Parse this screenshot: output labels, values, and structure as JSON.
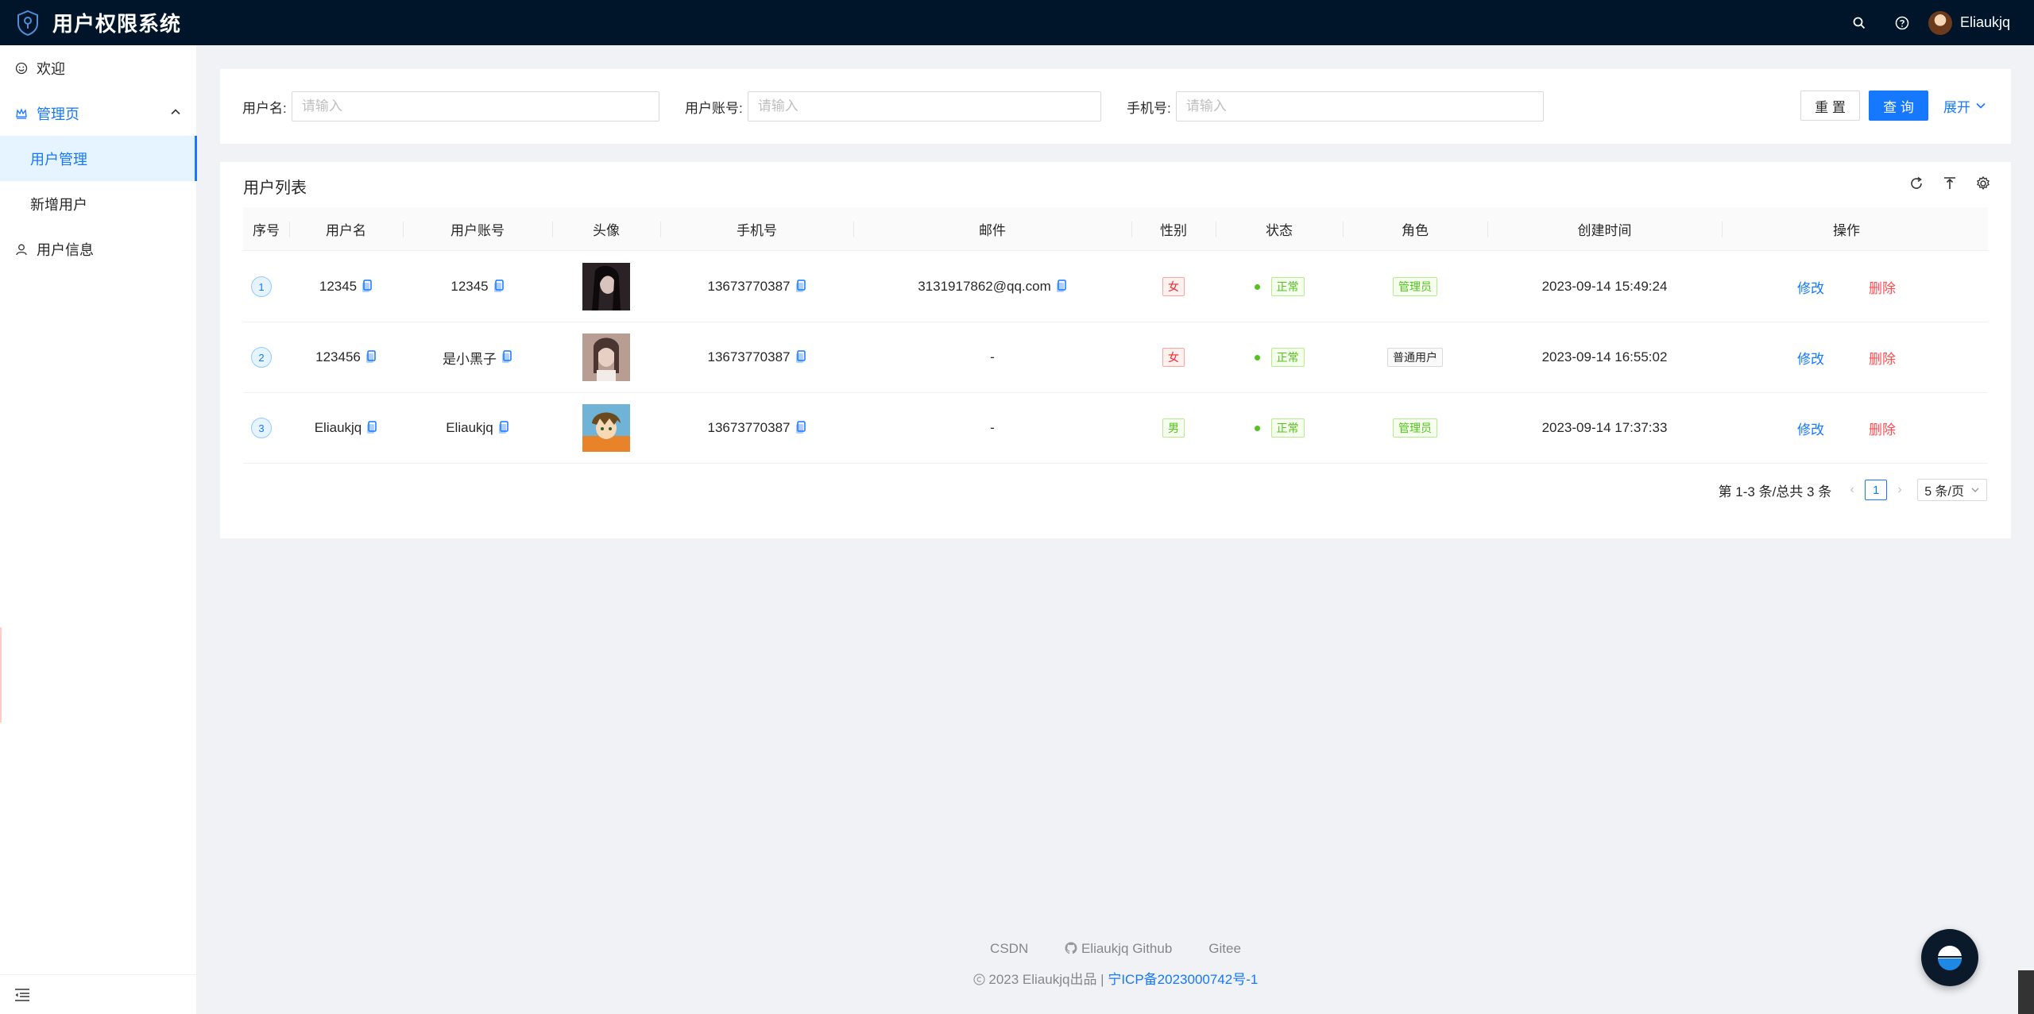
{
  "header": {
    "app_title": "用户权限系统",
    "user_name": "Eliaukjq"
  },
  "sidebar": {
    "items": [
      {
        "label": "欢迎",
        "icon": "smile-icon"
      },
      {
        "label": "管理页",
        "icon": "crown-icon"
      },
      {
        "label": "用户管理"
      },
      {
        "label": "新增用户"
      },
      {
        "label": "用户信息",
        "icon": "user-icon"
      }
    ]
  },
  "search": {
    "username_label": "用户名:",
    "account_label": "用户账号:",
    "phone_label": "手机号:",
    "placeholder": "请输入",
    "reset_label": "重 置",
    "query_label": "查 询",
    "expand_label": "展开"
  },
  "table": {
    "title": "用户列表",
    "columns": [
      "序号",
      "用户名",
      "用户账号",
      "头像",
      "手机号",
      "邮件",
      "性别",
      "状态",
      "角色",
      "创建时间",
      "操作"
    ],
    "rows": [
      {
        "index": "1",
        "username": "12345",
        "account": "12345",
        "phone": "13673770387",
        "email": "3131917862@qq.com",
        "gender": "女",
        "status": "正常",
        "role": "管理员",
        "created": "2023-09-14 15:49:24",
        "edit": "修改",
        "delete": "删除"
      },
      {
        "index": "2",
        "username": "123456",
        "account": "是小黑子",
        "phone": "13673770387",
        "email": "-",
        "gender": "女",
        "status": "正常",
        "role": "普通用户",
        "created": "2023-09-14 16:55:02",
        "edit": "修改",
        "delete": "删除"
      },
      {
        "index": "3",
        "username": "Eliaukjq",
        "account": "Eliaukjq",
        "phone": "13673770387",
        "email": "-",
        "gender": "男",
        "status": "正常",
        "role": "管理员",
        "created": "2023-09-14 17:37:33",
        "edit": "修改",
        "delete": "删除"
      }
    ]
  },
  "pagination": {
    "total_text": "第 1-3 条/总共 3 条",
    "current_page": "1",
    "page_size": "5 条/页"
  },
  "footer": {
    "links": [
      "CSDN",
      "Eliaukjq Github",
      "Gitee"
    ],
    "copyright": "2023 Eliaukjq出品 |",
    "icp": "宁ICP备2023000742号-1"
  },
  "colors": {
    "primary": "#1677ff",
    "header_bg": "#001529",
    "danger": "#ff4d4f",
    "success": "#52c41a"
  }
}
